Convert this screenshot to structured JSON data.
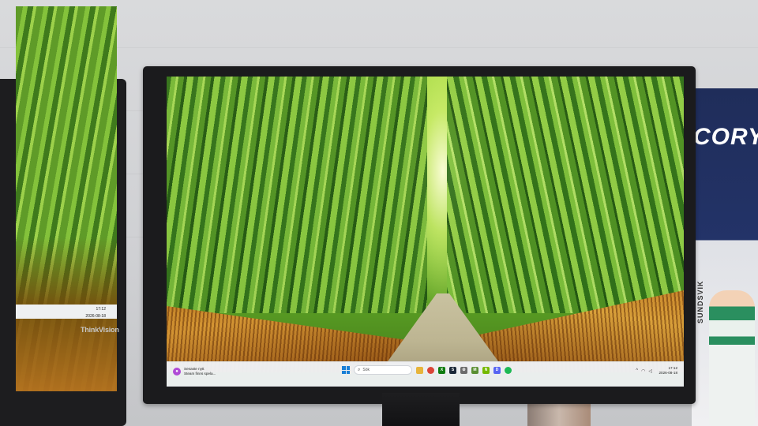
{
  "left_monitor": {
    "brand": "ThinkVision",
    "clock_time": "17:12",
    "clock_date": "2026-08-18"
  },
  "poster": {
    "headline": "CORY",
    "player_name": "ALBIN SUNDSVIK"
  },
  "taskbar": {
    "notification_title": "Senaste nytt",
    "notification_text": "Steam finns spela...",
    "search_placeholder": "Sök",
    "apps": [
      {
        "name": "file-explorer-icon",
        "color": "#e7b43a",
        "glyph": ""
      },
      {
        "name": "chrome-icon",
        "color": "#db4437",
        "glyph": ""
      },
      {
        "name": "xbox-icon",
        "color": "#107c10",
        "glyph": "X"
      },
      {
        "name": "steam-icon",
        "color": "#1b2838",
        "glyph": "S"
      },
      {
        "name": "settings-icon",
        "color": "#6b6b6b",
        "glyph": "⚙"
      },
      {
        "name": "minecraft-icon",
        "color": "#5a8f32",
        "glyph": "M"
      },
      {
        "name": "nvidia-icon",
        "color": "#76b900",
        "glyph": "N"
      },
      {
        "name": "discord-icon",
        "color": "#5865f2",
        "glyph": "D"
      },
      {
        "name": "spotify-icon",
        "color": "#1db954",
        "glyph": ""
      }
    ],
    "tray_icons": [
      "chevron-up-icon",
      "wifi-icon",
      "volume-icon"
    ],
    "clock_time": "17:12",
    "clock_date": "2026-08-18"
  }
}
